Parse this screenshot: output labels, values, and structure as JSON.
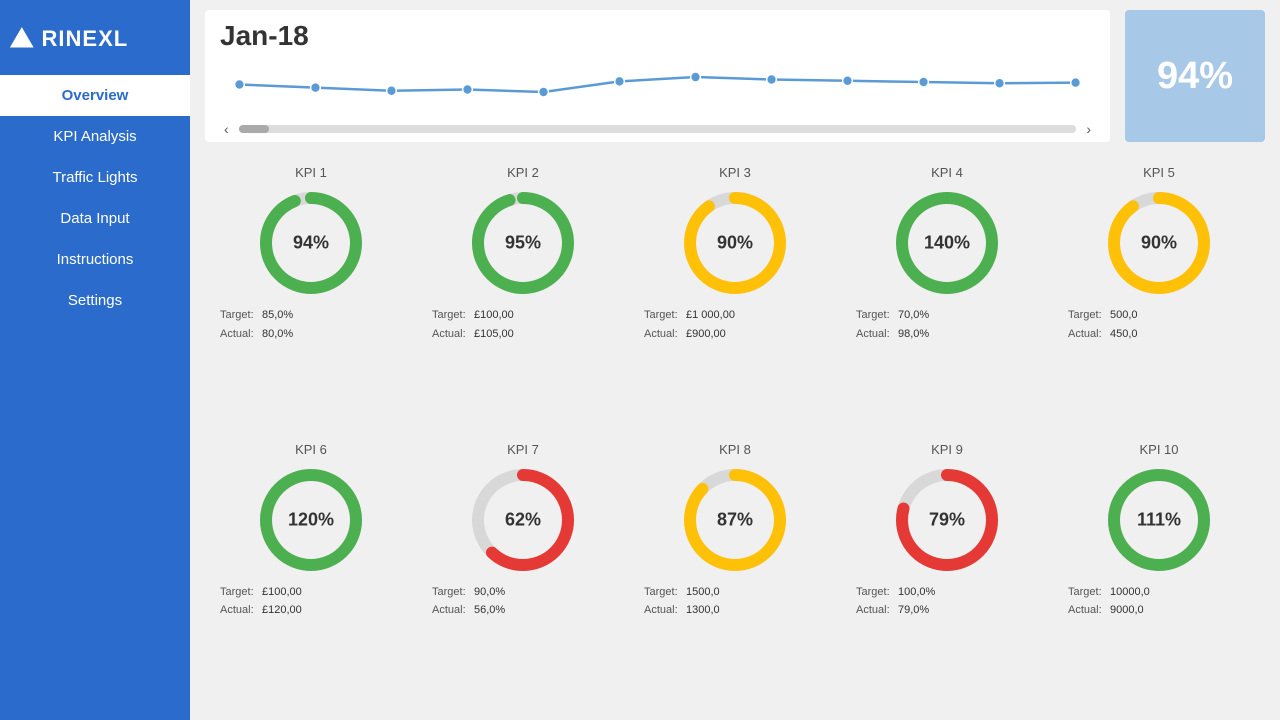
{
  "sidebar": {
    "logo_text": "RINEXL",
    "nav_items": [
      {
        "label": "Overview",
        "active": true
      },
      {
        "label": "KPI Analysis",
        "active": false
      },
      {
        "label": "Traffic Lights",
        "active": false
      },
      {
        "label": "Data Input",
        "active": false
      },
      {
        "label": "Instructions",
        "active": false
      },
      {
        "label": "Settings",
        "active": false
      }
    ]
  },
  "header": {
    "date": "Jan-18",
    "pct": "94%"
  },
  "kpis": [
    {
      "title": "KPI 1",
      "value": 94,
      "display": "94%",
      "color": "#4caf50",
      "bg": "#e8f5e9",
      "target_label": "Target:",
      "target_val": "85,0%",
      "actual_label": "Actual:",
      "actual_val": "80,0%"
    },
    {
      "title": "KPI 2",
      "value": 95,
      "display": "95%",
      "color": "#4caf50",
      "bg": "#e8f5e9",
      "target_label": "Target:",
      "target_val": "£100,00",
      "actual_label": "Actual:",
      "actual_val": "£105,00"
    },
    {
      "title": "KPI 3",
      "value": 90,
      "display": "90%",
      "color": "#ffc107",
      "bg": "#fff8e1",
      "target_label": "Target:",
      "target_val": "£1 000,00",
      "actual_label": "Actual:",
      "actual_val": "£900,00"
    },
    {
      "title": "KPI 4",
      "value": 100,
      "display": "140%",
      "color": "#4caf50",
      "bg": "#e8f5e9",
      "target_label": "Target:",
      "target_val": "70,0%",
      "actual_label": "Actual:",
      "actual_val": "98,0%"
    },
    {
      "title": "KPI 5",
      "value": 90,
      "display": "90%",
      "color": "#ffc107",
      "bg": "#fff8e1",
      "target_label": "Target:",
      "target_val": "500,0",
      "actual_label": "Actual:",
      "actual_val": "450,0"
    },
    {
      "title": "KPI 6",
      "value": 100,
      "display": "120%",
      "color": "#4caf50",
      "bg": "#e8f5e9",
      "target_label": "Target:",
      "target_val": "£100,00",
      "actual_label": "Actual:",
      "actual_val": "£120,00"
    },
    {
      "title": "KPI 7",
      "value": 62,
      "display": "62%",
      "color": "#e53935",
      "bg": "#ffebee",
      "target_label": "Target:",
      "target_val": "90,0%",
      "actual_label": "Actual:",
      "actual_val": "56,0%"
    },
    {
      "title": "KPI 8",
      "value": 87,
      "display": "87%",
      "color": "#ffc107",
      "bg": "#fff8e1",
      "target_label": "Target:",
      "target_val": "1500,0",
      "actual_label": "Actual:",
      "actual_val": "1300,0"
    },
    {
      "title": "KPI 9",
      "value": 79,
      "display": "79%",
      "color": "#e53935",
      "bg": "#ffebee",
      "target_label": "Target:",
      "target_val": "100,0%",
      "actual_label": "Actual:",
      "actual_val": "79,0%"
    },
    {
      "title": "KPI 10",
      "value": 100,
      "display": "111%",
      "color": "#4caf50",
      "bg": "#e8f5e9",
      "target_label": "Target:",
      "target_val": "10000,0",
      "actual_label": "Actual:",
      "actual_val": "9000,0"
    }
  ],
  "sparkline": {
    "points": [
      0.6,
      0.55,
      0.5,
      0.52,
      0.48,
      0.65,
      0.72,
      0.68,
      0.66,
      0.64,
      0.62,
      0.63
    ]
  }
}
